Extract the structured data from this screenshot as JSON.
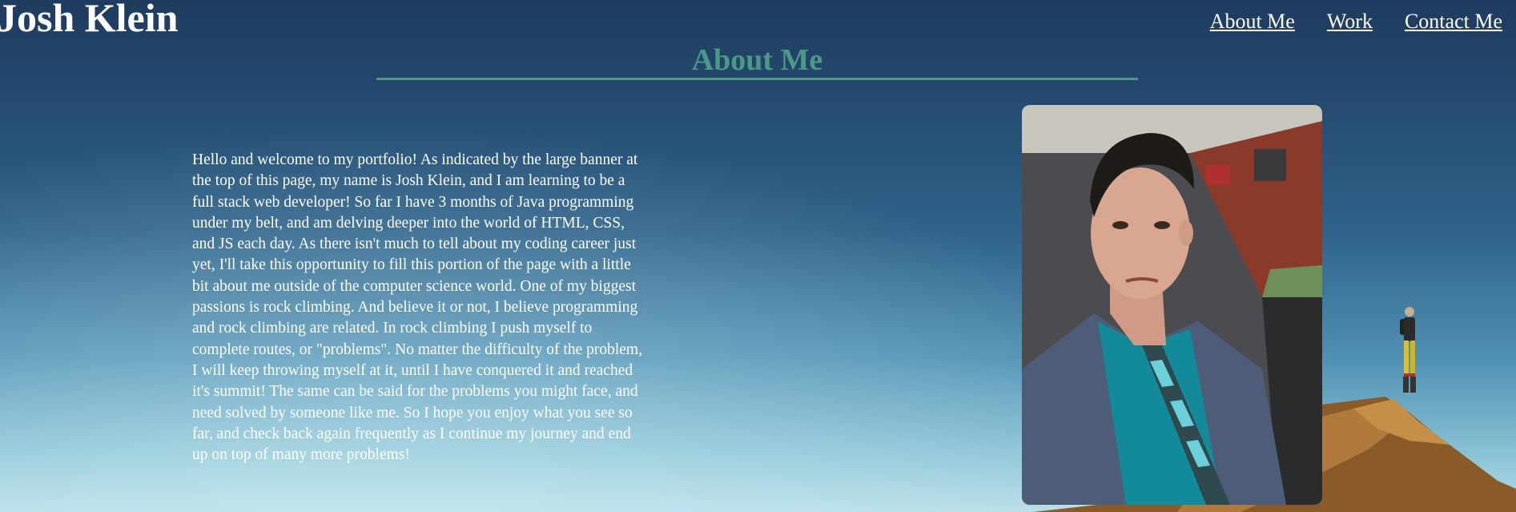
{
  "header": {
    "brand": "Josh Klein",
    "nav": [
      {
        "label": "About Me"
      },
      {
        "label": "Work"
      },
      {
        "label": "Contact Me"
      }
    ]
  },
  "main": {
    "title": "About Me",
    "bio": "Hello and welcome to my portfolio! As indicated by the large banner at the top of this page, my name is Josh Klein, and I am learning to be a full stack web developer! So far I have 3 months of Java programming under my belt, and am delving deeper into the world of HTML, CSS, and JS each day. As there isn't much to tell about my coding career just yet, I'll take this opportunity to fill this portion of the page with a little bit about me outside of the computer science world. One of my biggest passions is rock climbing. And believe it or not, I believe programming and rock climbing are related. In rock climbing I push myself to complete routes, or \"problems\". No matter the difficulty of the problem, I will keep throwing myself at it, until I have conquered it and reached it's summit! The same can be said for the problems you might face, and need solved by someone like me. So I hope you enjoy what you see so far, and check back again frequently as I continue my journey and end up on top of many more problems!"
  },
  "colors": {
    "accent": "#4a9a86",
    "text": "#ffffff",
    "sky_top": "#1f3b5e",
    "sky_bottom": "#b7dde6"
  }
}
